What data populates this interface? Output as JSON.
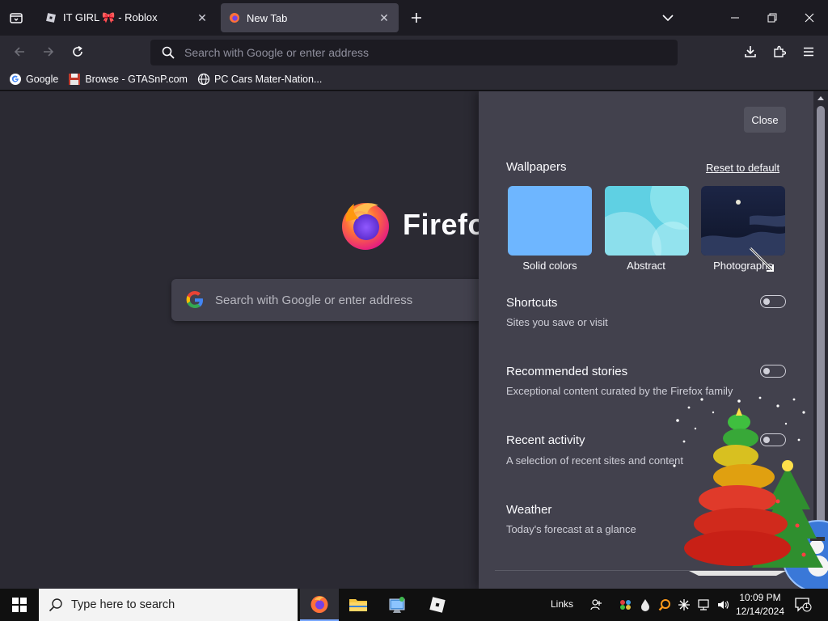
{
  "browser": {
    "tabs": [
      {
        "title": "IT GIRL 🎀 - Roblox",
        "active": false
      },
      {
        "title": "New Tab",
        "active": true
      }
    ],
    "urlbar_placeholder": "Search with Google or enter address",
    "bookmarks": [
      {
        "label": "Google",
        "icon": "google-g-icon"
      },
      {
        "label": "Browse - GTASnP.com",
        "icon": "floppy-icon"
      },
      {
        "label": "PC Cars Mater-Nation...",
        "icon": "globe-icon"
      }
    ]
  },
  "newtab": {
    "logo_text": "Firefox",
    "search_placeholder": "Search with Google or enter address"
  },
  "customize_panel": {
    "close_label": "Close",
    "wallpapers_heading": "Wallpapers",
    "reset_label": "Reset to default",
    "wallpapers": [
      {
        "label": "Solid colors",
        "color": "#6eb6ff"
      },
      {
        "label": "Abstract",
        "color": "#7fd8e8"
      },
      {
        "label": "Photographs",
        "color": "#1b2444"
      }
    ],
    "sections": [
      {
        "title": "Shortcuts",
        "subtitle": "Sites you save or visit",
        "enabled": false
      },
      {
        "title": "Recommended stories",
        "subtitle": "Exceptional content curated by the Firefox family",
        "enabled": false
      },
      {
        "title": "Recent activity",
        "subtitle": "A selection of recent sites and content",
        "enabled": false
      },
      {
        "title": "Weather",
        "subtitle": "Today's forecast at a glance"
      }
    ]
  },
  "taskbar": {
    "search_placeholder": "Type here to search",
    "links_label": "Links",
    "time": "10:09 PM",
    "date": "12/14/2024",
    "notification_count": "1"
  },
  "colors": {
    "toolbar": "#2b2a33",
    "frame": "#1c1b22",
    "panel": "#42414d",
    "taskbar": "#101010",
    "accent": "#7aa8ff"
  }
}
